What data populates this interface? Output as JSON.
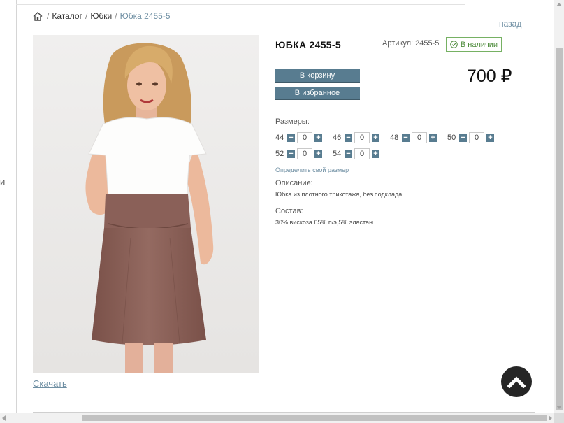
{
  "breadcrumb": {
    "home_icon": "home-icon",
    "separator": "/",
    "items": [
      "Каталог",
      "Юбки"
    ],
    "current": "Юбка 2455-5"
  },
  "back_link": "назад",
  "side_letter": "и",
  "product": {
    "title": "ЮБКА 2455-5",
    "sku": "Артикул: 2455-5",
    "stock": "В наличии",
    "stock_color": "#4e8c3c",
    "price": "700 ₽",
    "add_to_cart": "В корзину",
    "add_to_favorites": "В избранное",
    "sizes_label": "Размеры:",
    "sizes": [
      {
        "size": "44",
        "qty": "0"
      },
      {
        "size": "46",
        "qty": "0"
      },
      {
        "size": "48",
        "qty": "0"
      },
      {
        "size": "50",
        "qty": "0"
      },
      {
        "size": "52",
        "qty": "0"
      },
      {
        "size": "54",
        "qty": "0"
      }
    ],
    "size_help_link": "Определить свой размер",
    "description_label": "Описание:",
    "description": "Юбка из плотного трикотажа, без подклада",
    "composition_label": "Состав:",
    "composition": "30% вискоза 65% п/э,5% эластан"
  },
  "download_link": "Скачать",
  "colors": {
    "accent": "#587c90",
    "link": "#6f8fa3",
    "skirt": "#8a6058"
  },
  "icons": {
    "stock": "check-circle-icon",
    "minus": "minus-icon",
    "plus": "plus-icon",
    "scroll_top": "chevron-up-icon"
  }
}
